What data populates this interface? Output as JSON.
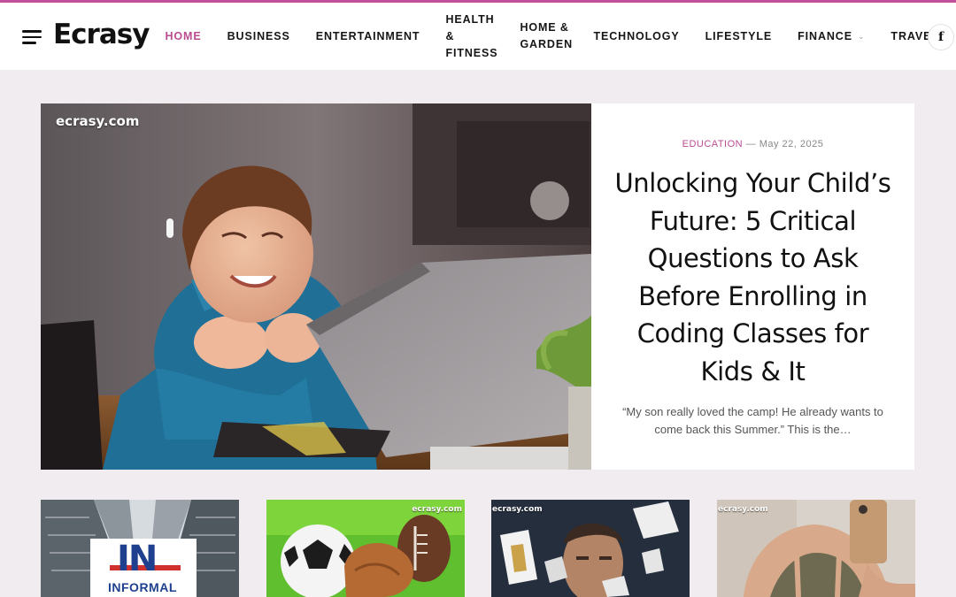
{
  "site": {
    "logo": "Ecrasy"
  },
  "nav": {
    "items": [
      {
        "label": "HOME",
        "active": true
      },
      {
        "label": "BUSINESS"
      },
      {
        "label": "ENTERTAINMENT"
      },
      {
        "label": "HEALTH & FITNESS"
      },
      {
        "label": "HOME & GARDEN"
      },
      {
        "label": "TECHNOLOGY"
      },
      {
        "label": "LIFESTYLE"
      },
      {
        "label": "FINANCE",
        "has_dropdown": true
      },
      {
        "label": "TRAVEL"
      }
    ],
    "social": {
      "facebook": "f"
    }
  },
  "hero": {
    "watermark": "ecrasy.com",
    "category": "EDUCATION",
    "date": "May 22, 2025",
    "date_sep": "—",
    "title": "Unlocking Your Child’s Future: 5 Critical Questions to Ask Before Enrolling in Coding Classes for Kids & It",
    "excerpt": "“My son really loved the camp! He already wants to come back this Summer.” This is the…"
  },
  "cards": [
    {
      "watermark": "",
      "logo_text": "IN",
      "logo_sub": "INFORMAL"
    },
    {
      "watermark": "ecrasy.com"
    },
    {
      "watermark": "ecrasy.com"
    },
    {
      "watermark": "ecrasy.com"
    }
  ],
  "colors": {
    "accent": "#bb4c92",
    "background": "#f0ecf0"
  }
}
